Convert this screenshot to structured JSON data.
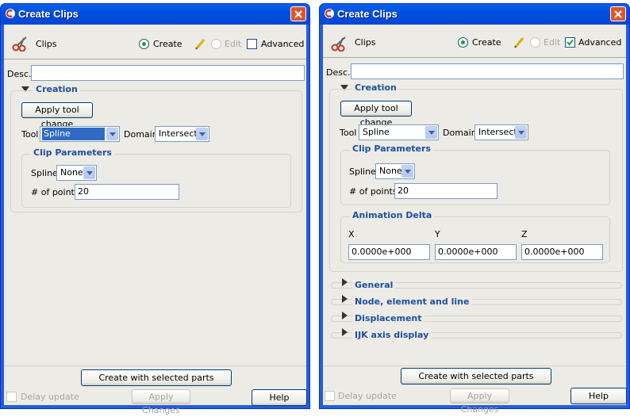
{
  "dialog_left": {
    "title": "Create Clips",
    "header": {
      "label": "Clips",
      "mode_create": "Create",
      "mode_edit": "Edit",
      "advanced": "Advanced",
      "advanced_checked": false
    },
    "desc_label": "Desc.",
    "desc_value": "",
    "creation": {
      "section_title": "Creation",
      "apply_tool_change": "Apply tool change",
      "tool_label": "Tool",
      "tool_value": "Spline",
      "domain_label": "Domain",
      "domain_value": "Intersect",
      "clip_params": {
        "title": "Clip Parameters",
        "spline_label": "Spline",
        "spline_value": "None",
        "points_label": "# of points",
        "points_value": "20"
      }
    },
    "footer": {
      "create_button": "Create with selected parts",
      "delay_update": "Delay update",
      "apply_changes": "Apply Changes",
      "help": "Help"
    }
  },
  "dialog_right": {
    "title": "Create Clips",
    "header": {
      "label": "Clips",
      "mode_create": "Create",
      "mode_edit": "Edit",
      "advanced": "Advanced",
      "advanced_checked": true
    },
    "desc_label": "Desc.",
    "desc_value": "",
    "creation": {
      "section_title": "Creation",
      "apply_tool_change": "Apply tool change",
      "tool_label": "Tool",
      "tool_value": "Spline",
      "domain_label": "Domain",
      "domain_value": "Intersect",
      "clip_params": {
        "title": "Clip Parameters",
        "spline_label": "Spline",
        "spline_value": "None",
        "points_label": "# of points",
        "points_value": "20"
      },
      "animation_delta": {
        "title": "Animation Delta",
        "x_label": "X",
        "y_label": "Y",
        "z_label": "Z",
        "x_value": "0.0000e+000",
        "y_value": "0.0000e+000",
        "z_value": "0.0000e+000"
      }
    },
    "collapsed_sections": [
      "General",
      "Node, element and line",
      "Displacement",
      "IJK axis display"
    ],
    "footer": {
      "create_button": "Create with selected parts",
      "delay_update": "Delay update",
      "apply_changes": "Apply Changes",
      "help": "Help"
    }
  },
  "colors": {
    "title_bar": "#0152e0",
    "section_title": "#1e50a0",
    "window_bg": "#ecebe6",
    "close_button": "#e0542c"
  },
  "icons": {
    "app": "app-logo-icon",
    "close": "close-icon",
    "clips": "scissors-icon",
    "edit": "pencil-icon"
  }
}
